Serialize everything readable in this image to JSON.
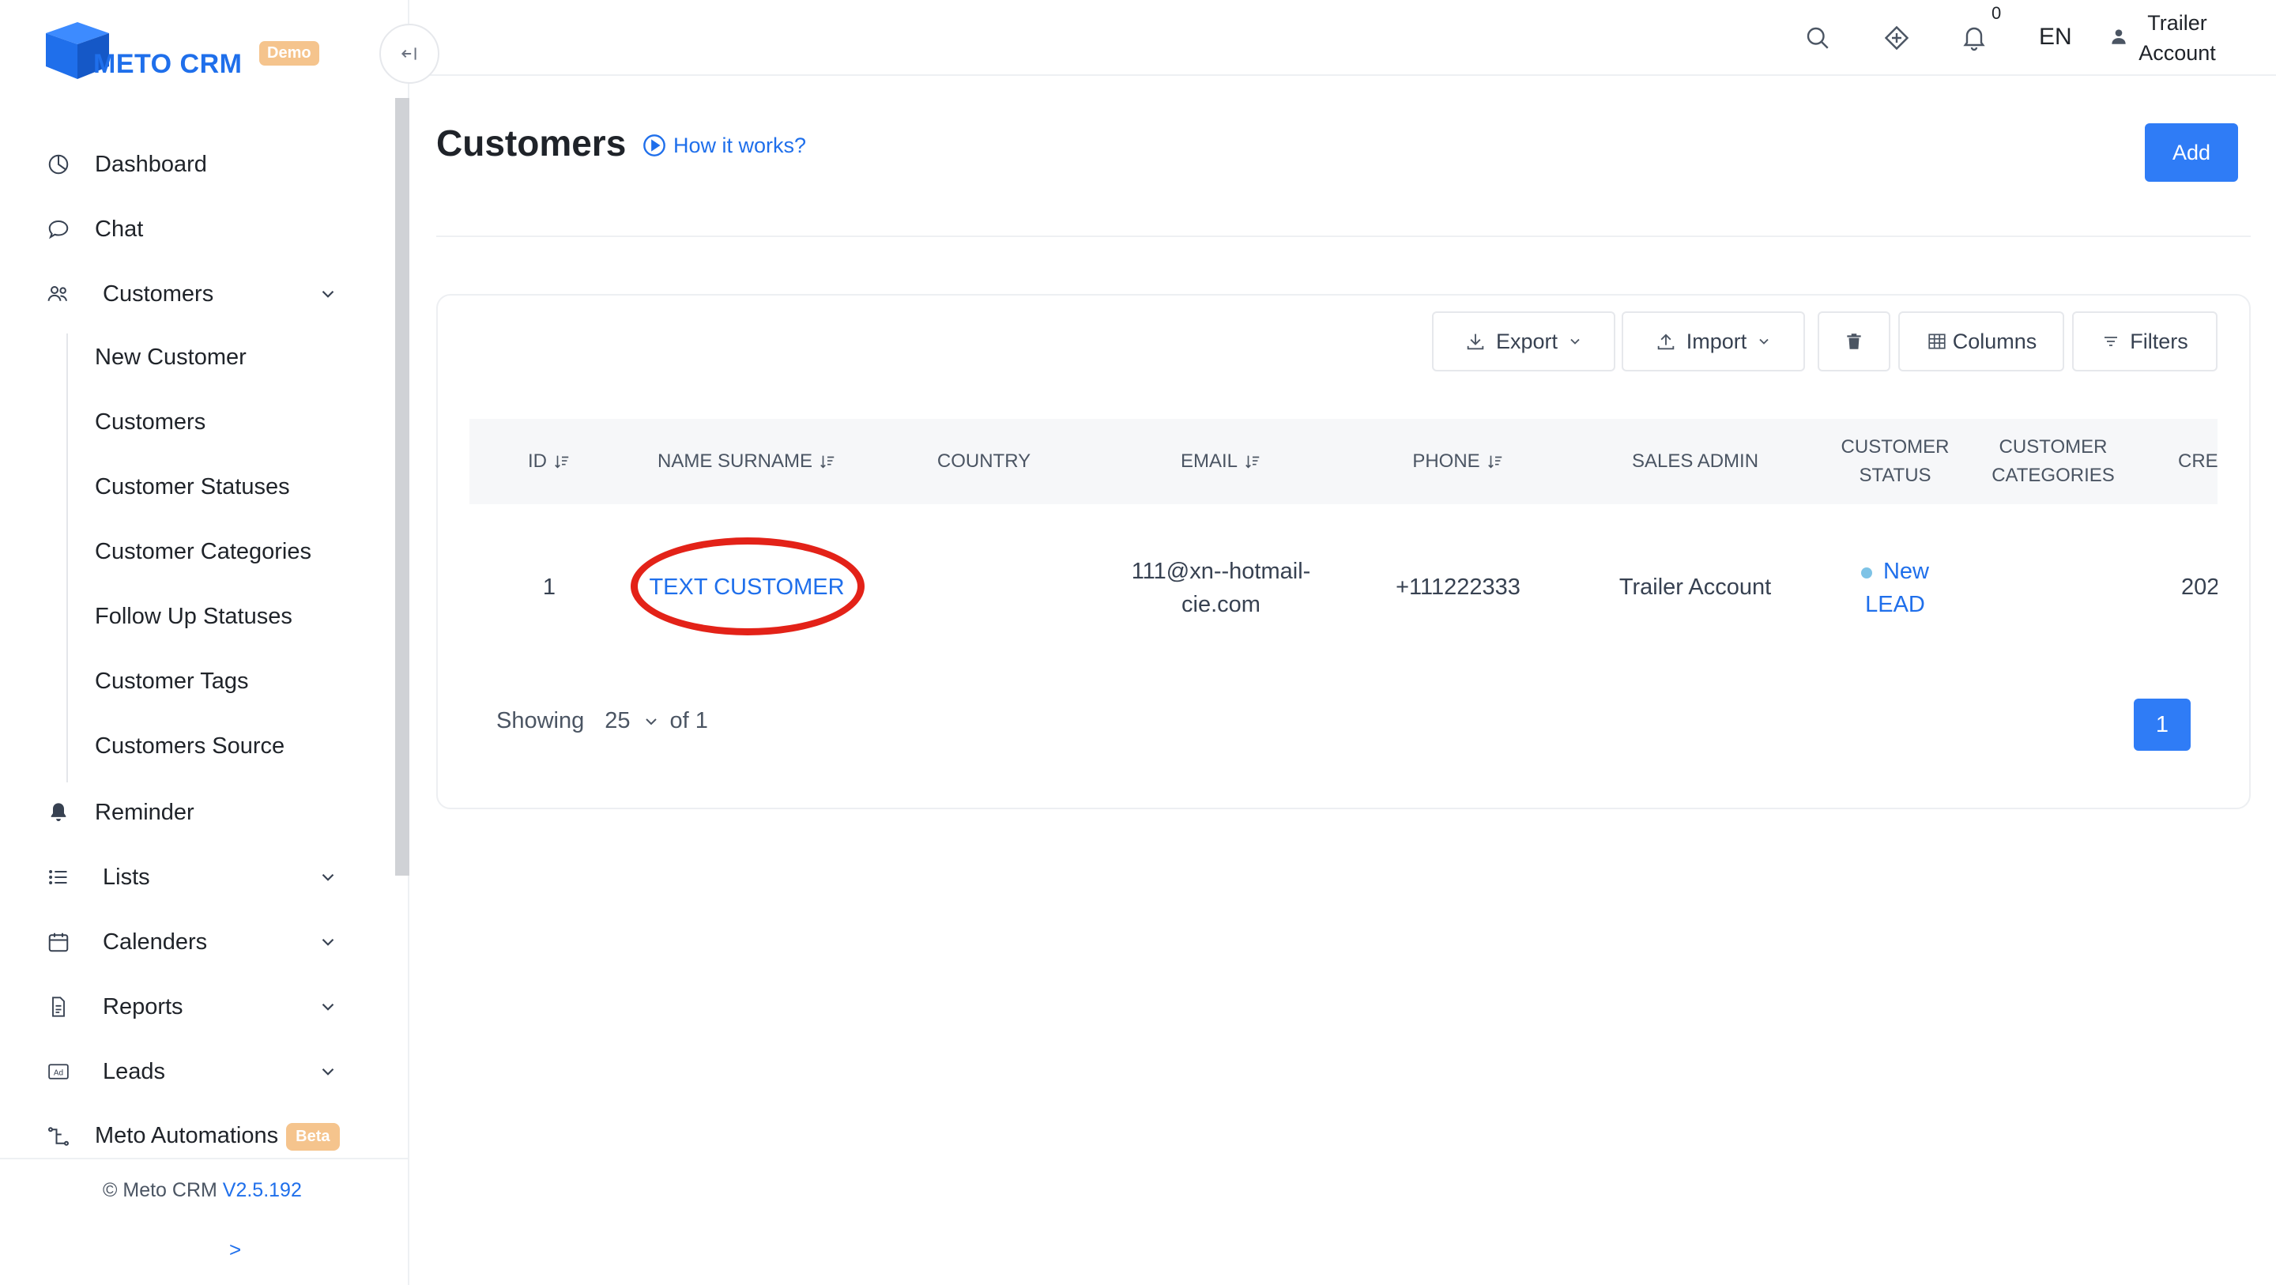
{
  "brand": {
    "name": "METO CRM",
    "badge": "Demo",
    "color": "#1f6feb"
  },
  "sidebar": {
    "items": [
      {
        "label": "Dashboard",
        "icon": "dashboard-icon"
      },
      {
        "label": "Chat",
        "icon": "chat-icon"
      },
      {
        "label": "Customers",
        "icon": "users-icon",
        "expanded": true,
        "children": [
          "New Customer",
          "Customers",
          "Customer Statuses",
          "Customer Categories",
          "Follow Up Statuses",
          "Customer Tags",
          "Customers Source"
        ]
      },
      {
        "label": "Reminder",
        "icon": "bell-icon"
      },
      {
        "label": "Lists",
        "icon": "list-icon"
      },
      {
        "label": "Calenders",
        "icon": "calendar-icon"
      },
      {
        "label": "Reports",
        "icon": "report-icon"
      },
      {
        "label": "Leads",
        "icon": "ad-icon"
      },
      {
        "label": "Meto Automations",
        "icon": "automation-icon",
        "badge": "Beta"
      }
    ],
    "footer": {
      "copyright": "© Meto CRM",
      "version": "V2.5.192",
      "expand": ">"
    }
  },
  "topbar": {
    "notification_count": "0",
    "language": "EN",
    "user_line1": "Trailer",
    "user_line2": "Account"
  },
  "page": {
    "title": "Customers",
    "how_it_works": "How it works?",
    "add_label": "Add"
  },
  "toolbar": {
    "export": "Export",
    "import": "Import",
    "columns": "Columns",
    "filters": "Filters"
  },
  "table": {
    "headers": {
      "id": "ID",
      "name": "NAME SURNAME",
      "country": "COUNTRY",
      "email": "EMAIL",
      "phone": "PHONE",
      "sales_admin": "SALES ADMIN",
      "status_1": "CUSTOMER",
      "status_2": "STATUS",
      "categories_1": "CUSTOMER",
      "categories_2": "CATEGORIES",
      "created": "CRE"
    },
    "rows": [
      {
        "id": "1",
        "name": "TEXT CUSTOMER",
        "country": "",
        "email_1": "111@xn--hotmail-",
        "email_2": "cie.com",
        "phone": "+111222333",
        "sales_admin": "Trailer Account",
        "status_1": "New",
        "status_2": "LEAD",
        "categories": "",
        "created": "202"
      }
    ]
  },
  "pagination": {
    "showing_label": "Showing",
    "page_size": "25",
    "of_label": "of 1",
    "current_page": "1"
  },
  "annotation": {
    "color": "#e32218"
  }
}
